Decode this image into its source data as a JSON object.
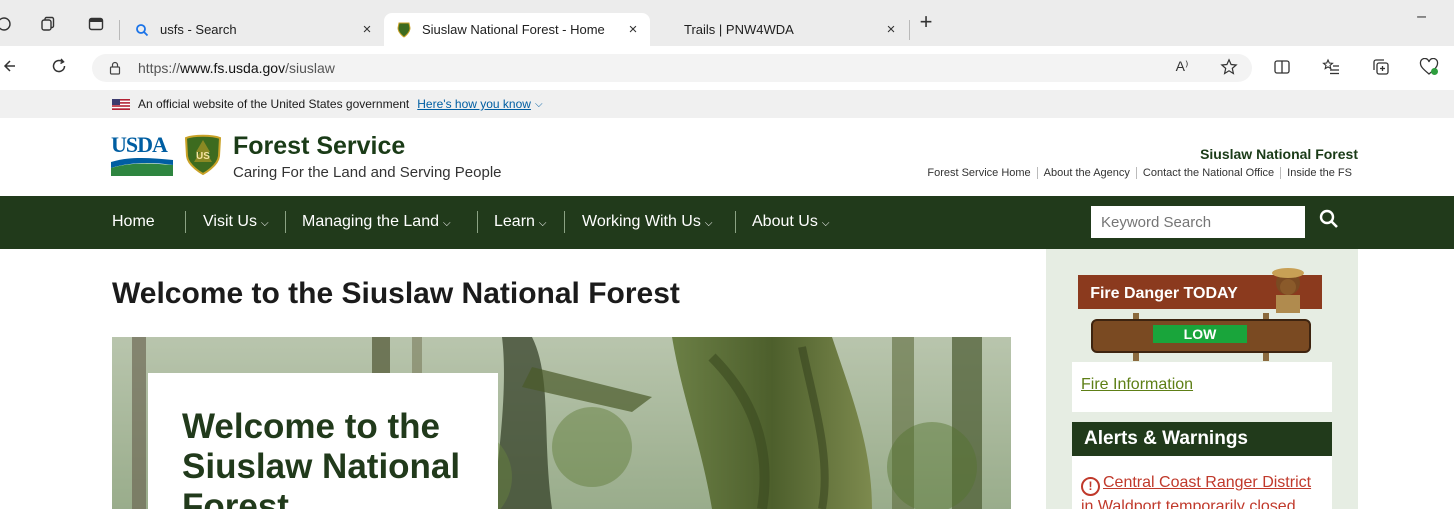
{
  "browser": {
    "tabs": [
      {
        "title": "usfs - Search",
        "active": false
      },
      {
        "title": "Siuslaw National Forest - Home",
        "active": true
      },
      {
        "title": "Trails | PNW4WDA",
        "active": false
      }
    ],
    "new_tab": "+",
    "close_glyph": "×",
    "url_prefix": "https://",
    "url_host": "www.fs.usda.gov",
    "url_path": "/siuslaw",
    "read_aloud": "A⁾",
    "minimize": "–"
  },
  "gov_banner": {
    "text": "An official website of the United States government",
    "link": "Here's how you know"
  },
  "header": {
    "usda_logo": "USDA",
    "shield_text": "US",
    "title": "Forest Service",
    "tagline": "Caring For the Land and Serving People",
    "forest_name": "Siuslaw National Forest",
    "utility_links": [
      "Forest Service Home",
      "About the Agency",
      "Contact the National Office",
      "Inside the FS"
    ]
  },
  "nav": {
    "items": [
      {
        "label": "Home",
        "dropdown": false
      },
      {
        "label": "Visit Us",
        "dropdown": true
      },
      {
        "label": "Managing the Land",
        "dropdown": true
      },
      {
        "label": "Learn",
        "dropdown": true
      },
      {
        "label": "Working With Us",
        "dropdown": true
      },
      {
        "label": "About Us",
        "dropdown": true
      }
    ],
    "search_placeholder": "Keyword Search"
  },
  "main": {
    "page_title": "Welcome to the Siuslaw National Forest",
    "hero_card_title": "Welcome to the Siuslaw National Forest"
  },
  "sidebar": {
    "fire_danger_title": "Fire Danger TODAY",
    "fire_danger_level": "LOW",
    "fire_info_link": "Fire Information",
    "alerts_heading": "Alerts & Warnings",
    "alert_1": "Central Coast Ranger District in Waldport temporarily closed"
  },
  "colors": {
    "nav_green": "#213a1b",
    "link_green": "#5e7f16",
    "alert_red": "#c0392b",
    "usda_blue": "#005ea2"
  }
}
